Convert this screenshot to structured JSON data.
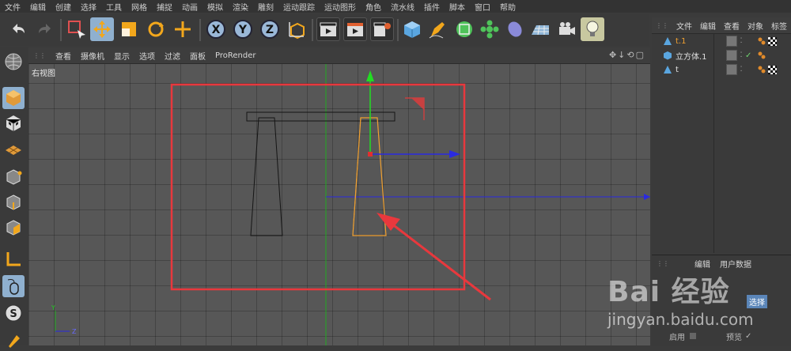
{
  "menu_bar": [
    "文件",
    "编辑",
    "创建",
    "选择",
    "工具",
    "网格",
    "捕捉",
    "动画",
    "模拟",
    "渲染",
    "雕刻",
    "运动跟踪",
    "运动图形",
    "角色",
    "流水线",
    "插件",
    "脚本",
    "窗口",
    "帮助"
  ],
  "viewport_menu": [
    "查看",
    "摄像机",
    "显示",
    "选项",
    "过滤",
    "面板",
    "ProRender"
  ],
  "viewport_label": "右视图",
  "axis_labels": {
    "y": "Y",
    "z": "Z"
  },
  "object_panel": {
    "menu": [
      "文件",
      "编辑",
      "查看",
      "对象",
      "标签"
    ],
    "objects": [
      {
        "name": "t.1",
        "active": true,
        "icon": "bend-deformer-icon",
        "check": ""
      },
      {
        "name": "立方体.1",
        "active": false,
        "icon": "cube-icon",
        "check": "✓"
      },
      {
        "name": "t",
        "active": false,
        "icon": "bend-deformer-icon",
        "check": ""
      }
    ]
  },
  "attr_panel": {
    "menu": [
      "编辑",
      "用户数据"
    ],
    "selected_label": "选择",
    "row_label_enable": "启用",
    "row_label_preview": "预览",
    "row_check": "✓"
  },
  "watermark": {
    "logo": "Bai 经验",
    "url": "jingyan.baidu.com"
  },
  "colors": {
    "highlight_box": "#e8383d",
    "selected_object": "#f0a030",
    "axis_x": "#2222dd",
    "axis_y": "#22cc22"
  }
}
